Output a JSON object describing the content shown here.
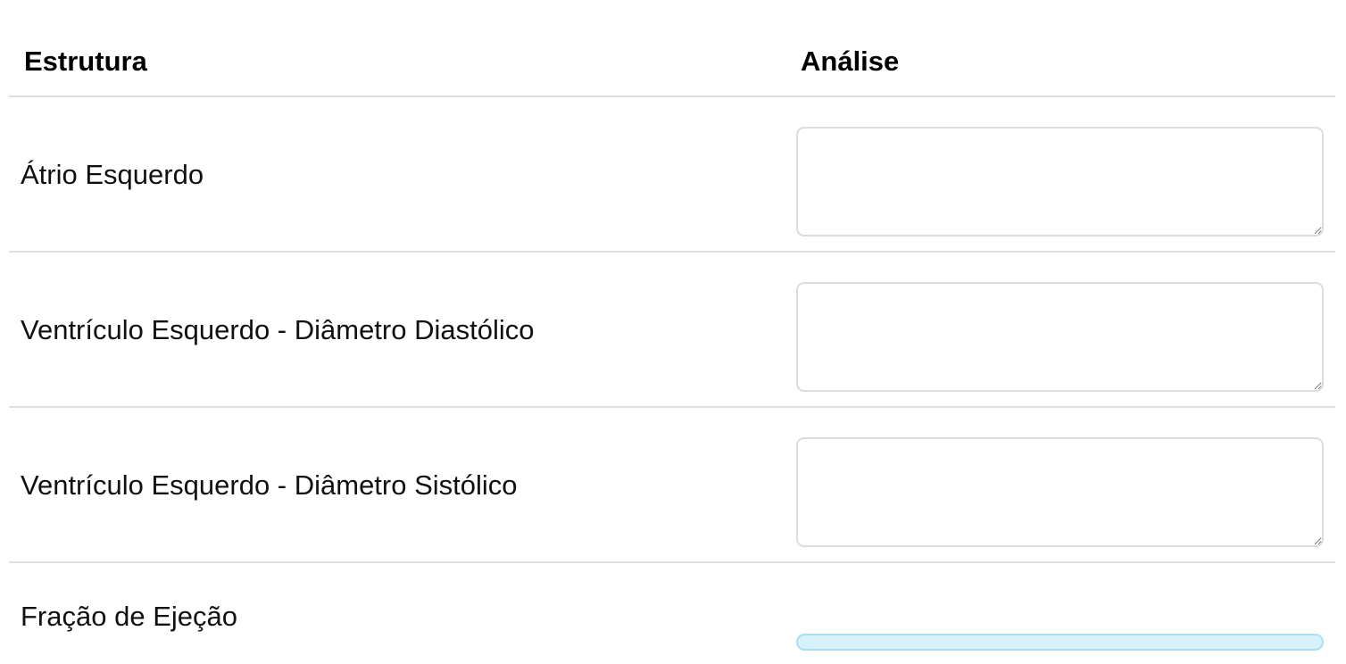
{
  "table": {
    "headers": {
      "structure": "Estrutura",
      "analysis": "Análise"
    },
    "rows": [
      {
        "label": "Átrio Esquerdo",
        "analysis_value": ""
      },
      {
        "label": "Ventrículo Esquerdo - Diâmetro Diastólico",
        "analysis_value": ""
      },
      {
        "label": "Ventrículo Esquerdo - Diâmetro Sistólico",
        "analysis_value": ""
      },
      {
        "label": "Fração de Ejeção"
      }
    ]
  },
  "colors": {
    "border": "#dedede",
    "input_border": "#dcdcdc",
    "ejection_bar_fill": "#d8f2fb",
    "ejection_bar_border": "#a9dff0"
  }
}
